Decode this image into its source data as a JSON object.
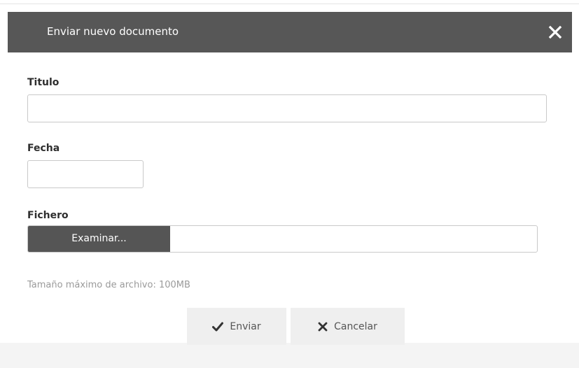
{
  "dialog": {
    "title": "Enviar nuevo documento",
    "close_icon": "close-icon"
  },
  "form": {
    "titulo": {
      "label": "Titulo",
      "value": ""
    },
    "fecha": {
      "label": "Fecha",
      "value": ""
    },
    "fichero": {
      "label": "Fichero",
      "browse_label": "Examinar...",
      "file_name": ""
    },
    "hint": "Tamaño máximo de archivo: 100MB"
  },
  "actions": {
    "submit": {
      "label": "Enviar",
      "icon": "checkmark-icon"
    },
    "cancel": {
      "label": "Cancelar",
      "icon": "x-icon"
    }
  },
  "colors": {
    "header_bg": "#575757",
    "browse_bg": "#555555",
    "button_bg": "#efefef"
  }
}
